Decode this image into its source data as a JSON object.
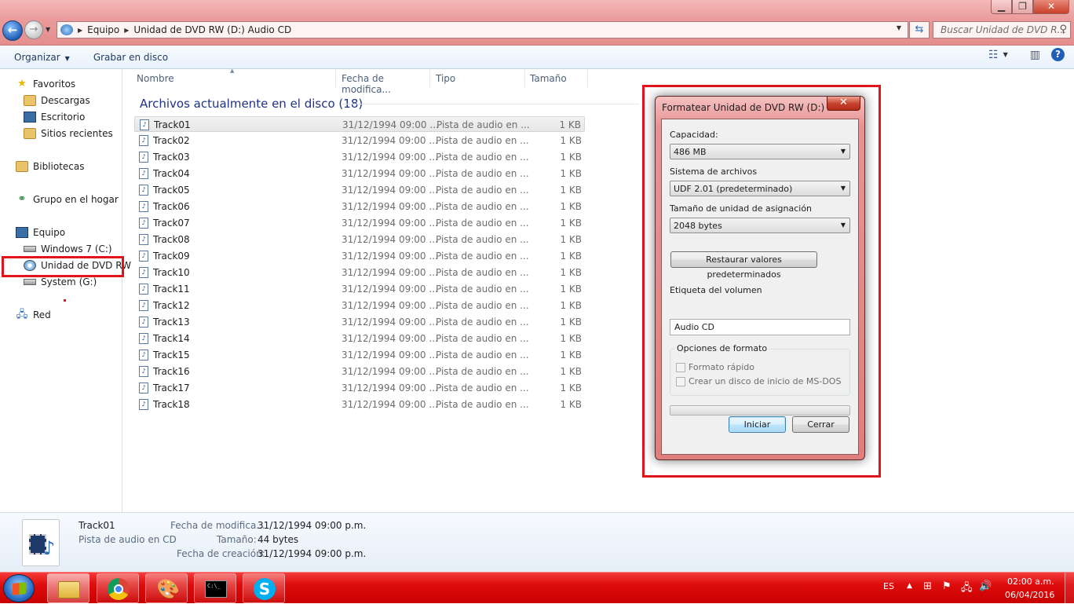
{
  "window": {
    "controls": {
      "minimize": "▭",
      "maximize": "❐",
      "close": "✕"
    }
  },
  "address": {
    "crumbs": [
      "Equipo",
      "Unidad de DVD RW (D:) Audio CD"
    ],
    "search_placeholder": "Buscar Unidad de DVD R..."
  },
  "toolbar": {
    "organize": "Organizar",
    "burn": "Grabar en disco"
  },
  "nav": {
    "favorites": "Favoritos",
    "downloads": "Descargas",
    "desktop": "Escritorio",
    "recent": "Sitios recientes",
    "libraries": "Bibliotecas",
    "homegroup": "Grupo en el hogar",
    "computer": "Equipo",
    "drive_c": "Windows 7 (C:)",
    "drive_d": "Unidad de DVD RW",
    "drive_g": "System (G:)",
    "network": "Red"
  },
  "columns": {
    "name": "Nombre",
    "modified": "Fecha de modifica...",
    "type": "Tipo",
    "size": "Tamaño"
  },
  "group_title": "Archivos actualmente en el disco (18)",
  "files": [
    {
      "name": "Track01",
      "date": "31/12/1994 09:00 ...",
      "type": "Pista de audio en ...",
      "size": "1 KB"
    },
    {
      "name": "Track02",
      "date": "31/12/1994 09:00 ...",
      "type": "Pista de audio en ...",
      "size": "1 KB"
    },
    {
      "name": "Track03",
      "date": "31/12/1994 09:00 ...",
      "type": "Pista de audio en ...",
      "size": "1 KB"
    },
    {
      "name": "Track04",
      "date": "31/12/1994 09:00 ...",
      "type": "Pista de audio en ...",
      "size": "1 KB"
    },
    {
      "name": "Track05",
      "date": "31/12/1994 09:00 ...",
      "type": "Pista de audio en ...",
      "size": "1 KB"
    },
    {
      "name": "Track06",
      "date": "31/12/1994 09:00 ...",
      "type": "Pista de audio en ...",
      "size": "1 KB"
    },
    {
      "name": "Track07",
      "date": "31/12/1994 09:00 ...",
      "type": "Pista de audio en ...",
      "size": "1 KB"
    },
    {
      "name": "Track08",
      "date": "31/12/1994 09:00 ...",
      "type": "Pista de audio en ...",
      "size": "1 KB"
    },
    {
      "name": "Track09",
      "date": "31/12/1994 09:00 ...",
      "type": "Pista de audio en ...",
      "size": "1 KB"
    },
    {
      "name": "Track10",
      "date": "31/12/1994 09:00 ...",
      "type": "Pista de audio en ...",
      "size": "1 KB"
    },
    {
      "name": "Track11",
      "date": "31/12/1994 09:00 ...",
      "type": "Pista de audio en ...",
      "size": "1 KB"
    },
    {
      "name": "Track12",
      "date": "31/12/1994 09:00 ...",
      "type": "Pista de audio en ...",
      "size": "1 KB"
    },
    {
      "name": "Track13",
      "date": "31/12/1994 09:00 ...",
      "type": "Pista de audio en ...",
      "size": "1 KB"
    },
    {
      "name": "Track14",
      "date": "31/12/1994 09:00 ...",
      "type": "Pista de audio en ...",
      "size": "1 KB"
    },
    {
      "name": "Track15",
      "date": "31/12/1994 09:00 ...",
      "type": "Pista de audio en ...",
      "size": "1 KB"
    },
    {
      "name": "Track16",
      "date": "31/12/1994 09:00 ...",
      "type": "Pista de audio en ...",
      "size": "1 KB"
    },
    {
      "name": "Track17",
      "date": "31/12/1994 09:00 ...",
      "type": "Pista de audio en ...",
      "size": "1 KB"
    },
    {
      "name": "Track18",
      "date": "31/12/1994 09:00 ...",
      "type": "Pista de audio en ...",
      "size": "1 KB"
    }
  ],
  "details": {
    "name": "Track01",
    "type": "Pista de audio en CD",
    "modified_label": "Fecha de modifica...",
    "modified_value": "31/12/1994 09:00 p.m.",
    "size_label": "Tamaño:",
    "size_value": "44 bytes",
    "created_label": "Fecha de creación:",
    "created_value": "31/12/1994 09:00 p.m."
  },
  "dialog": {
    "title": "Formatear Unidad de DVD RW (D:) A...",
    "capacity_label": "Capacidad:",
    "capacity_value": "486 MB",
    "filesystem_label": "Sistema de archivos",
    "filesystem_value": "UDF 2.01 (predeterminado)",
    "alloc_label": "Tamaño de unidad de asignación",
    "alloc_value": "2048 bytes",
    "restore_button": "Restaurar valores predeterminados",
    "volume_label": "Etiqueta del volumen",
    "volume_value": "Audio CD",
    "options_legend": "Opciones de formato",
    "quick_format": "Formato rápido",
    "msdos_disk": "Crear un disco de inicio de MS-DOS",
    "start_button": "Iniciar",
    "close_button": "Cerrar"
  },
  "taskbar": {
    "lang": "ES",
    "time": "02:00 a.m.",
    "date": "06/04/2016",
    "cmd_glyph": "C:\\_"
  },
  "colors": {
    "accent_red": "#e0141a",
    "taskbar_red": "#de0c0c",
    "link_blue": "#1e3287"
  }
}
